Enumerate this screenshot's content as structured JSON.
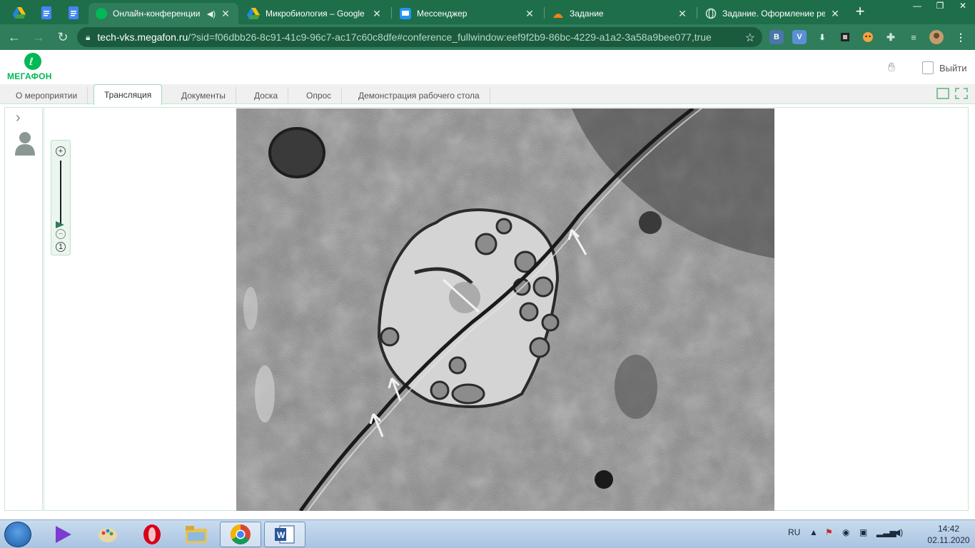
{
  "browser": {
    "tabs": [
      {
        "title": "Онлайн-конференции",
        "has_sound": true
      },
      {
        "title": "Микробиология – Google Д"
      },
      {
        "title": "Мессенджер"
      },
      {
        "title": "Задание"
      },
      {
        "title": "Задание. Оформление реф"
      }
    ],
    "new_tab_label": "+",
    "window_controls": {
      "minimize": "—",
      "restore": "❐",
      "close": "✕"
    },
    "url_domain": "tech-vks.megafon.ru",
    "url_path": "/?sid=f06dbb26-8c91-41c9-96c7-ac17c60c8dfe#conference_fullwindow:eef9f2b9-86bc-4229-a1a2-3a58a9bee077,true",
    "extensions": [
      {
        "label": "В",
        "color": "#4a76a8"
      },
      {
        "label": "V",
        "color": "#5b8fd6"
      }
    ],
    "accent": "#2f7d5b"
  },
  "app": {
    "logo_text": "МЕГАФОН",
    "brand_color": "#00b956",
    "exit_label": "Выйти",
    "tabs": [
      {
        "label": "О мероприятии"
      },
      {
        "label": "Трансляция",
        "active": true
      },
      {
        "label": "Документы"
      },
      {
        "label": "Доска"
      },
      {
        "label": "Опрос"
      },
      {
        "label": "Демонстрация рабочего стола"
      }
    ],
    "zoom": {
      "plus": "+",
      "minus": "−",
      "reset": "1",
      "level": 0.0
    }
  },
  "taskbar": {
    "language": "RU",
    "time": "14:42",
    "date": "02.11.2020",
    "running_app": "chrome-icon"
  }
}
